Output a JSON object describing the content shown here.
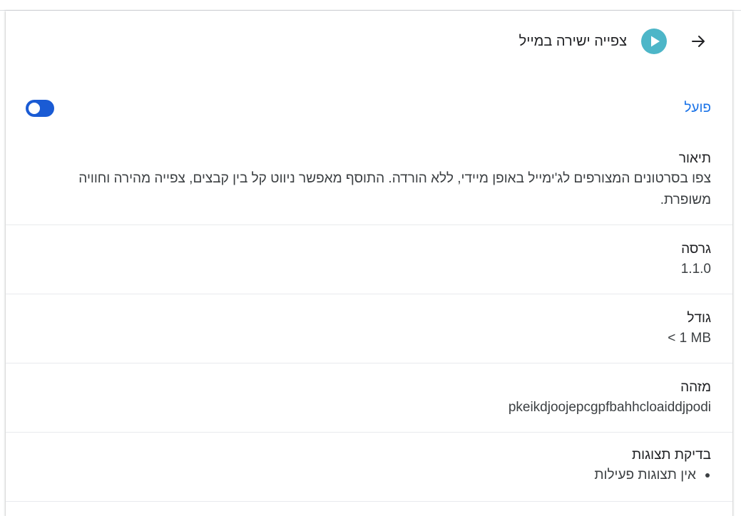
{
  "header": {
    "title": "צפייה ישירה במייל",
    "back_icon": "arrow-back-icon",
    "extension_icon": "play-circle-icon",
    "icon_color": "#4db6c8"
  },
  "status": {
    "on_label": "פועל",
    "toggle_on": true,
    "accent": "#1a73e8"
  },
  "sections": {
    "description": {
      "label": "תיאור",
      "value": "צפו בסרטונים המצורפים לג'ימייל באופן מיידי, ללא הורדה. התוסף מאפשר ניווט קל בין קבצים, צפייה מהירה וחוויה משופרת."
    },
    "version": {
      "label": "גרסה",
      "value": "1.1.0"
    },
    "size": {
      "label": "גודל",
      "value": "< 1 MB"
    },
    "id": {
      "label": "מזהה",
      "value": "pkeikdjoojepcgpfbahhcloaiddjpodi"
    },
    "inspect_views": {
      "label": "בדיקת תצוגות",
      "items": [
        "אין תצוגות פעילות"
      ]
    }
  }
}
